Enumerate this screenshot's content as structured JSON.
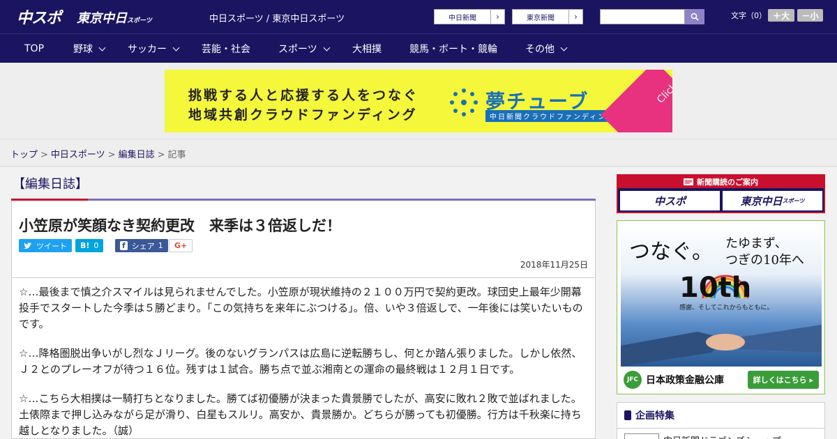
{
  "header": {
    "logo_main": "中スポ",
    "logo_tokyo": "東京中日",
    "logo_tokyo_small": "スポーツ",
    "site_names": "中日スポーツ / 東京中日スポーツ",
    "ext_links": [
      {
        "label": "中日新聞",
        "arrow": "›"
      },
      {
        "label": "東京新聞",
        "arrow": "›"
      }
    ],
    "search_icon": "search-icon",
    "font_size_label": "文字（0）",
    "font_larger": "＋大",
    "font_smaller": "－小"
  },
  "nav": {
    "items": [
      {
        "label": "TOP",
        "has_menu": false
      },
      {
        "label": "野球",
        "has_menu": true
      },
      {
        "label": "サッカー",
        "has_menu": true
      },
      {
        "label": "芸能・社会",
        "has_menu": false
      },
      {
        "label": "スポーツ",
        "has_menu": true
      },
      {
        "label": "大相撲",
        "has_menu": false
      },
      {
        "label": "競馬・ボート・競輪",
        "has_menu": false
      },
      {
        "label": "その他",
        "has_menu": true
      }
    ]
  },
  "banner": {
    "line1": "挑戦する人と応援する人をつなぐ",
    "line2": "地域共創クラウドファンディング",
    "brand": "夢チューブ",
    "sub": "中日新聞クラウドファンディング",
    "click": "Click!",
    "brand_color": "#1a6fb8",
    "bg_color": "#f4f73a"
  },
  "breadcrumb": {
    "items": [
      "トップ",
      "中日スポーツ",
      "編集日誌"
    ],
    "current": "記事",
    "separator": ">"
  },
  "section": {
    "title": "【編集日誌】"
  },
  "article": {
    "title": "小笠原が笑顔なき契約更改　来季は３倍返しだ！",
    "share": {
      "tweet": "ツイート",
      "hatena_count": "0",
      "facebook_label": "シェア",
      "facebook_count": "1",
      "gplus": "G+"
    },
    "date": "2018年11月25日",
    "paragraphs": [
      "☆…最後まで慎之介スマイルは見られませんでした。小笠原が現状維持の２１００万円で契約更改。球団史上最年少開幕投手でスタートした今季は５勝どまり。「この気持ちを来年にぶつける」。倍、いや３倍返しで、一年後には笑いたいものです。",
      "☆…降格圏脱出争いがし烈なＪリーグ。後のないグランパスは広島に逆転勝ちし、何とか踏ん張りました。しかし依然、Ｊ２とのプレーオフが待つ１６位。残すは１試合。勝ち点で並ぶ湘南との運命の最終戦は１２月１日です。",
      "☆…こちら大相撲は一騎打ちとなりました。勝てば初優勝が決まった貴景勝でしたが、高安に敗れ２敗で並ばれました。土俵際まで押し込みながら足が滑り、白星もスルリ。高安か、貴景勝か。どちらが勝っても初優勝。行方は千秋楽に持ち越しとなりました。（誠）"
    ]
  },
  "sidebar": {
    "subscription": {
      "heading": "新聞購読のご案内",
      "logo_main": "中スポ",
      "logo_tokyo": "東京中日",
      "logo_tokyo_small": "スポーツ"
    },
    "ad": {
      "headline": "つなぐ。",
      "subline1": "たゆまず、",
      "subline2": "つぎの10年へ",
      "tenth": "10th",
      "tenth_sub": "感謝、そしてこれからもともに。",
      "jfc": "JFC",
      "name": "日本政策金融公庫",
      "more": "詳しくはこちら ▸"
    },
    "feature": {
      "title": "企画特集",
      "item": "中日新聞ドラゴンズショップ"
    }
  }
}
